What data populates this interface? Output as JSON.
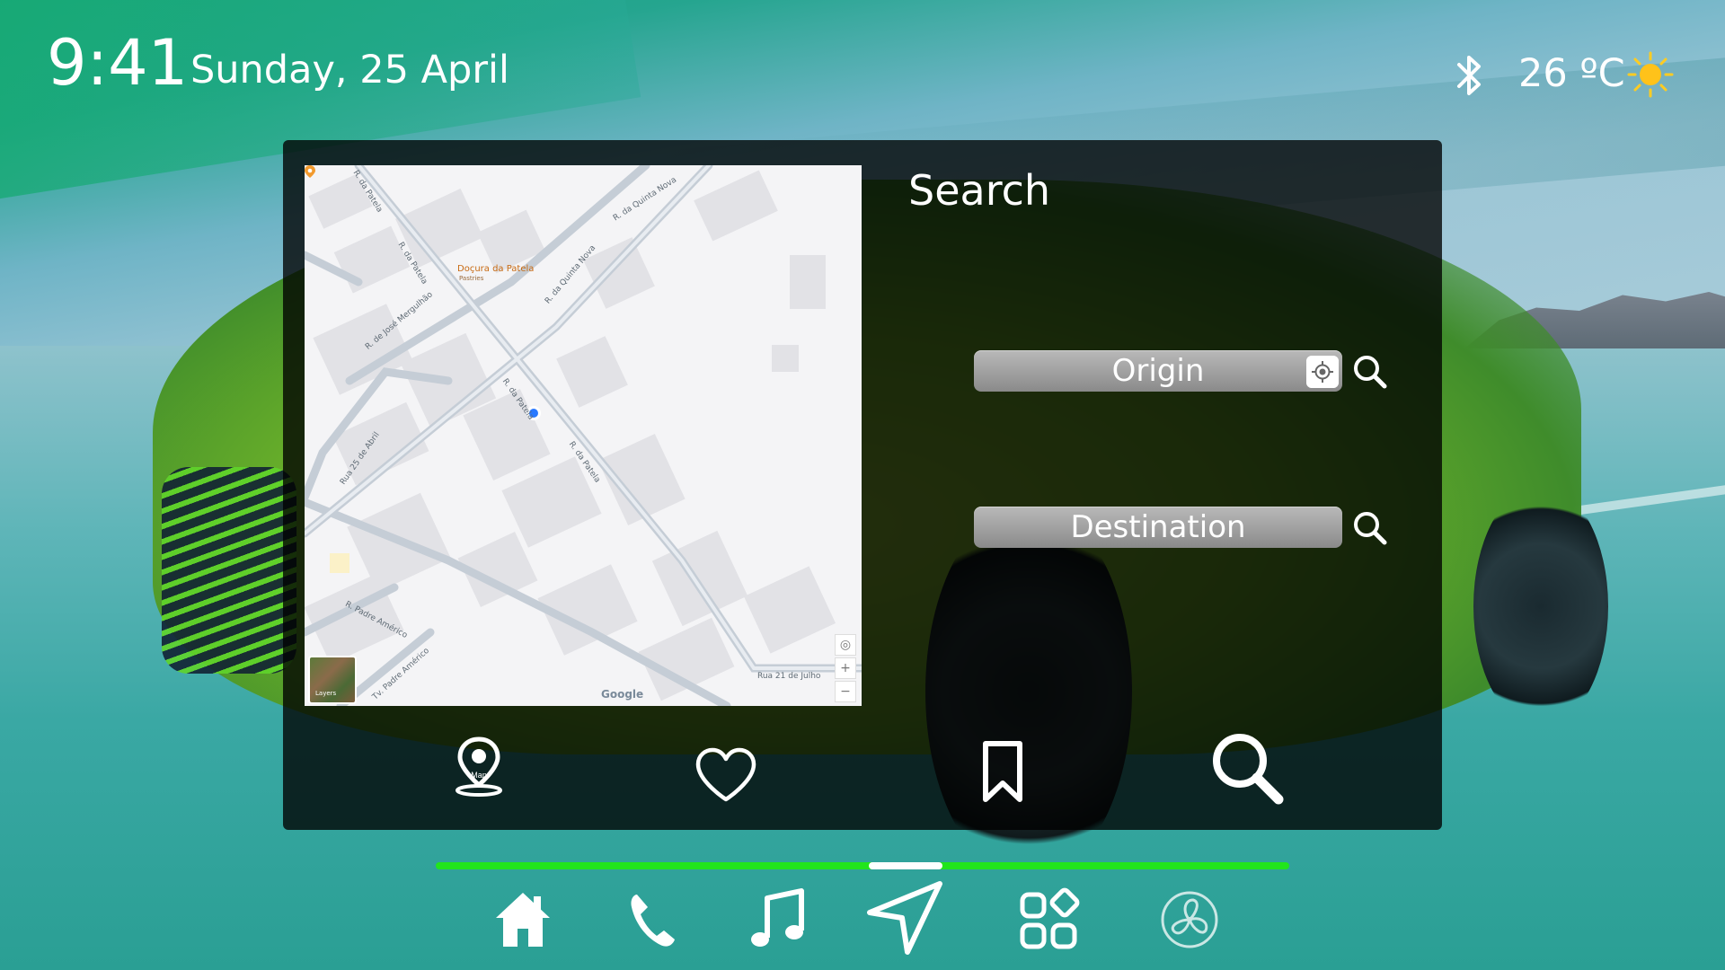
{
  "status_bar": {
    "time": "9:41",
    "date": "Sunday, 25 April",
    "bluetooth_icon": "bluetooth-icon",
    "temperature": "26 ºC",
    "weather_icon": "sun-icon"
  },
  "search_panel": {
    "title": "Search",
    "origin": {
      "label": "Origin",
      "locate_icon": "crosshair-icon",
      "search_icon": "search-icon"
    },
    "destination": {
      "label": "Destination",
      "search_icon": "search-icon"
    },
    "map": {
      "poi_name": "Doçura da Patela",
      "poi_subtitle": "Pastries",
      "street_labels": [
        "R. da Patela",
        "R. da Patela",
        "R. da Quinta Nova",
        "R. da Quinta Nova",
        "R. de José Mergulhão",
        "R. da Patela",
        "R. da Patela",
        "Rua 25 de Abril",
        "R. Padre Américo",
        "Tv. Padre Américo",
        "Rua 21 de Julho"
      ],
      "attribution": "Google",
      "layers_label": "Layers",
      "zoom_in": "+",
      "zoom_out": "−"
    },
    "tabs": [
      {
        "name": "map",
        "icon": "map-pin-icon",
        "label": "Map"
      },
      {
        "name": "favorites",
        "icon": "heart-icon"
      },
      {
        "name": "saved",
        "icon": "bookmark-icon"
      },
      {
        "name": "search",
        "icon": "search-icon"
      }
    ]
  },
  "page_indicator": {
    "color": "#22e51c",
    "active_color": "#ffffff",
    "active_fraction_start": 0.507,
    "active_fraction_end": 0.594
  },
  "dock": [
    {
      "name": "home",
      "icon": "home-icon"
    },
    {
      "name": "phone",
      "icon": "phone-icon"
    },
    {
      "name": "music",
      "icon": "music-note-icon"
    },
    {
      "name": "navigation",
      "icon": "navigation-arrow-icon"
    },
    {
      "name": "apps",
      "icon": "apps-grid-icon"
    },
    {
      "name": "climate",
      "icon": "fan-icon"
    }
  ]
}
